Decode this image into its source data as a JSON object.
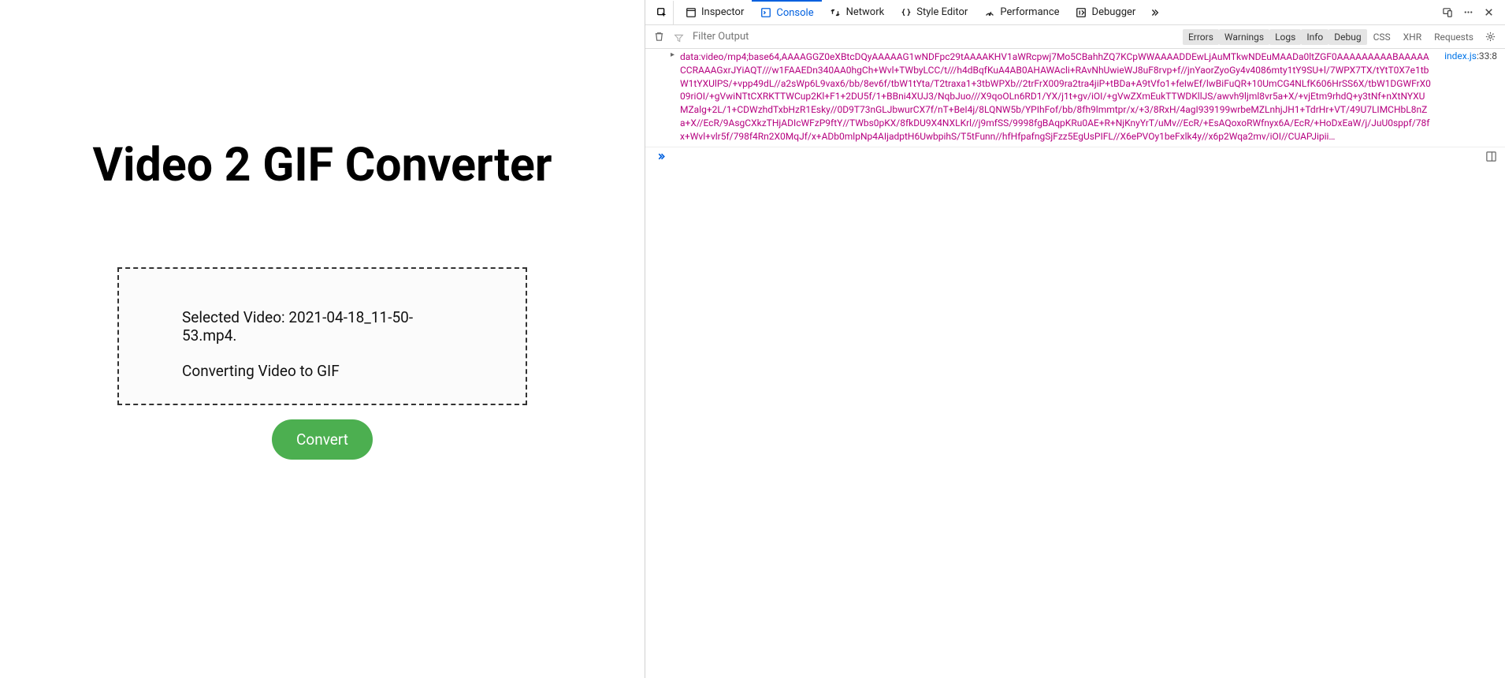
{
  "app": {
    "title": "Video 2 GIF Converter",
    "dropzone": {
      "selected_label": "Selected Video: 2021-04-18_11-50-53.mp4.",
      "status": "Converting Video to GIF"
    },
    "convert_button": "Convert"
  },
  "devtools": {
    "tabs": {
      "inspector": "Inspector",
      "console": "Console",
      "network": "Network",
      "style_editor": "Style Editor",
      "performance": "Performance",
      "debugger": "Debugger"
    },
    "filter": {
      "placeholder": "Filter Output"
    },
    "levels": {
      "errors": "Errors",
      "warnings": "Warnings",
      "logs": "Logs",
      "info": "Info",
      "debug": "Debug",
      "css": "CSS",
      "xhr": "XHR",
      "requests": "Requests"
    },
    "console_msg": {
      "text": "data:video/mp4;base64,AAAAGGZ0eXBtcDQyAAAAAG1wNDFpc29tAAAAKHV1aWRcpwj7Mo5CBahhZQ7KCpWWAAAADDEwLjAuMTkwNDEuMAADa0ltZGF0AAAAAAAAABAAAAACCRAAAGxrJYiAQT///w1FAAEDn340AA0hgCh+Wvl+TWbyLCC/t///h4dBqfKuA4AB0AHAWAcli+RAvNhUwieWJ8uF8rvp+f//jnYaorZyoGy4v4086mty1tY9SU+l/7WPX7TX/tYtT0X7e1tbW1tYXUlPS/+vpp49dL//a2sWp6L9vax6/bb/8ev6f/tbW1tYta/T2traxa1+3tbWPXb//2trFrX009ra2tra4jiP+tBDa+A9tVfo1+feIwEf/lwBiFuQR+10UmCG4NLfK606HrSS6X/tbW1DGWFrX009riOI/+gVwiNTtCXRKTTWCup2Kl+F1+2DU5f/1+BBni4XUJ3/NqbJuo///X9qoOLn6RD1/YX/j1t+gv/iOI/+gVwZXmEukTTWDKllJS/awvh9ljml8vr5a+X/+vjEtm9rhdQ+y3tNf+nXtNYXUMZalg+2L/1+CDWzhdTxbHzR1Esky//0D9T73nGLJbwurCX7f/nT+BeI4j/8LQNW5b/YPIhFof/bb/8fh9lmmtpr/x/+3/8RxH/4agI939199wrbeMZLnhjJH1+TdrHr+VT/49U7LIMCHbL8nZa+X//EcR/9AsgCXkzTHjADIcWFzP9ftY//TWbs0pKX/8fkDU9X4NXLKrl//j9mfSS/9998fgBAqpKRu0AE+R+NjKnyYrT/uMv//EcR/+EsAQoxoRWfnyx6A/EcR/+HoDxEaW/j/JuU0sppf/78fx+Wvl+vlr5f/798f4Rn2X0MqJf/x+ADb0mlpNp4AIjadptH6UwbpihS/T5tFunn//hfHfpafngSjFzz5EgUsPIFL//X6ePVOy1beFxlk4y//x6p2Wqa2mv/iOI//CUAPJipii…",
      "location_file": "index.js",
      "location_line": ":33:8"
    }
  }
}
